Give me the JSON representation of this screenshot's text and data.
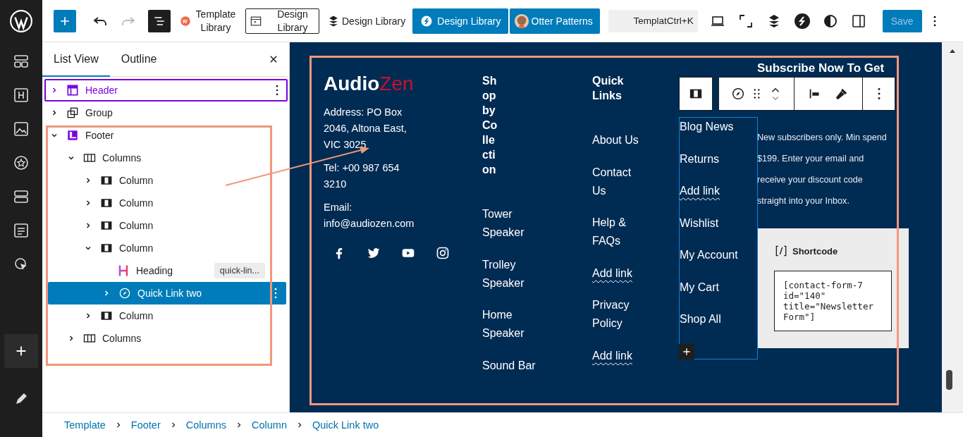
{
  "toolbar": {
    "template_library": "Template Library",
    "design_library_boxed": "Design Library",
    "design_library_plain": "Design Library",
    "design_library_button": "Design Library",
    "otter_patterns": "Otter Patterns",
    "command": "Templat",
    "shortcut": "Ctrl+K",
    "save": {
      "label": "Save",
      "disabled": true
    }
  },
  "list_view": {
    "tabs": [
      {
        "label": "List View",
        "selected": true
      },
      {
        "label": "Outline",
        "selected": false
      }
    ],
    "tree": [
      {
        "label": "Header",
        "kind": "header",
        "expanded": false,
        "selected": false,
        "outlined": true
      },
      {
        "label": "Group",
        "kind": "group",
        "expanded": false,
        "selected": false,
        "outlined": false
      },
      {
        "label": "Footer",
        "kind": "footer",
        "expanded": true,
        "selected": false,
        "outlined": false,
        "children": [
          {
            "label": "Columns",
            "kind": "columns",
            "expanded": true,
            "selected": false,
            "outlined": false,
            "children": [
              {
                "label": "Column",
                "kind": "column",
                "expanded": false,
                "selected": false,
                "outlined": false
              },
              {
                "label": "Column",
                "kind": "column",
                "expanded": false,
                "selected": false,
                "outlined": false
              },
              {
                "label": "Column",
                "kind": "column",
                "expanded": false,
                "selected": false,
                "outlined": false
              },
              {
                "label": "Column",
                "kind": "column",
                "expanded": true,
                "selected": false,
                "outlined": false,
                "children": [
                  {
                    "label": "Heading",
                    "kind": "heading",
                    "selected": false,
                    "outlined": false,
                    "badge": "quick-lin..."
                  },
                  {
                    "label": "Quick Link two",
                    "kind": "navigation",
                    "expanded": false,
                    "selected": true,
                    "outlined": false
                  }
                ]
              },
              {
                "label": "Column",
                "kind": "column",
                "expanded": false,
                "selected": false,
                "outlined": false
              }
            ]
          },
          {
            "label": "Columns",
            "kind": "columns",
            "expanded": false,
            "selected": false,
            "outlined": false
          }
        ]
      }
    ]
  },
  "footer": {
    "logo": {
      "first": "Audio",
      "second": "Zen"
    },
    "address": "Address: PO Box 2046, Altona East, VIC 3025",
    "tel": "Tel: +00 987 654 3210",
    "email_label": "Email:",
    "email": "info@audiozen.com",
    "link_columns": [
      {
        "heading": "Shop by Collection",
        "selected": false,
        "links": [
          {
            "label": "Tower Speaker",
            "kind": "link"
          },
          {
            "label": "Trolley Speaker",
            "kind": "link"
          },
          {
            "label": "Home Speaker",
            "kind": "link"
          },
          {
            "label": "Sound Bar",
            "kind": "link"
          }
        ]
      },
      {
        "heading": "Quick Links",
        "selected": false,
        "links": [
          {
            "label": "About Us",
            "kind": "link"
          },
          {
            "label": "Contact Us",
            "kind": "link"
          },
          {
            "label": "Help & FAQs",
            "kind": "link"
          },
          {
            "label": "Add link",
            "kind": "add_link"
          },
          {
            "label": "Privacy Policy",
            "kind": "link"
          },
          {
            "label": "Add link",
            "kind": "add_link"
          }
        ]
      },
      {
        "selected": true,
        "links": [
          {
            "label": "Blog News",
            "kind": "link"
          },
          {
            "label": "Returns",
            "kind": "link"
          },
          {
            "label": "Add link",
            "kind": "add_link"
          },
          {
            "label": "Wishlist",
            "kind": "link"
          },
          {
            "label": "My Account",
            "kind": "link"
          },
          {
            "label": "My Cart",
            "kind": "link"
          },
          {
            "label": "Shop All",
            "kind": "link"
          }
        ]
      }
    ],
    "subscribe": {
      "title": "Subscribe Now To Get",
      "text": "New subscribers only. Min spend $199. Enter your email and receive your discount code straight into your Inbox.",
      "shortcode_label": "Shortcode",
      "shortcode_value": "[contact-form-7 id=\"140\" title=\"Newsletter Form\"]"
    }
  },
  "breadcrumb": [
    "Template",
    "Footer",
    "Columns",
    "Column",
    "Quick Link two"
  ]
}
